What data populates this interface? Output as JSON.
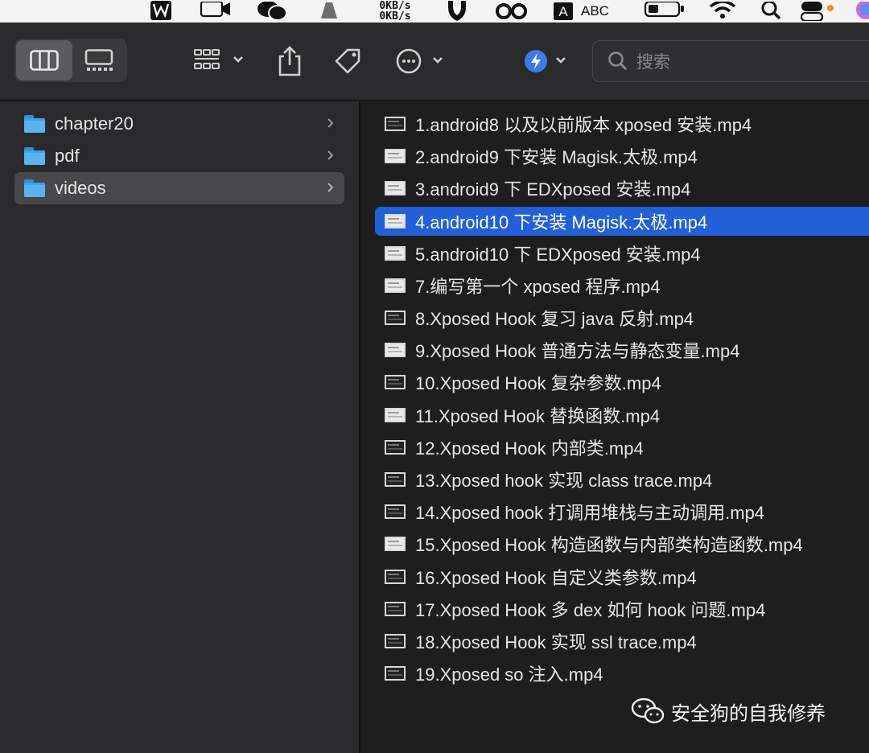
{
  "menubar": {
    "net_up": "0KB/s",
    "net_down": "0KB/s",
    "input_letter": "A",
    "input_label": "ABC"
  },
  "toolbar": {
    "search_placeholder": "搜索",
    "accent": "#2160d6"
  },
  "sidebar": {
    "items": [
      {
        "label": "chapter20",
        "selected": false
      },
      {
        "label": "pdf",
        "selected": false
      },
      {
        "label": "videos",
        "selected": true
      }
    ]
  },
  "files": [
    {
      "name": "1.android8 以及以前版本 xposed 安装.mp4",
      "selected": false
    },
    {
      "name": "2.android9 下安装 Magisk.太极.mp4",
      "selected": false
    },
    {
      "name": "3.android9 下 EDXposed 安装.mp4",
      "selected": false
    },
    {
      "name": "4.android10 下安装 Magisk.太极.mp4",
      "selected": true
    },
    {
      "name": "5.android10 下 EDXposed 安装.mp4",
      "selected": false
    },
    {
      "name": "7.编写第一个 xposed 程序.mp4",
      "selected": false
    },
    {
      "name": "8.Xposed Hook 复习 java 反射.mp4",
      "selected": false
    },
    {
      "name": "9.Xposed Hook 普通方法与静态变量.mp4",
      "selected": false
    },
    {
      "name": "10.Xposed Hook 复杂参数.mp4",
      "selected": false
    },
    {
      "name": "11.Xposed Hook 替换函数.mp4",
      "selected": false
    },
    {
      "name": "12.Xposed Hook 内部类.mp4",
      "selected": false
    },
    {
      "name": "13.Xposed hook 实现 class trace.mp4",
      "selected": false
    },
    {
      "name": "14.Xposed hook 打调用堆栈与主动调用.mp4",
      "selected": false
    },
    {
      "name": "15.Xposed Hook 构造函数与内部类构造函数.mp4",
      "selected": false
    },
    {
      "name": "16.Xposed Hook 自定义类参数.mp4",
      "selected": false
    },
    {
      "name": "17.Xposed Hook 多 dex 如何 hook 问题.mp4",
      "selected": false
    },
    {
      "name": "18.Xposed Hook 实现 ssl trace.mp4",
      "selected": false
    },
    {
      "name": "19.Xposed so 注入.mp4",
      "selected": false
    }
  ],
  "watermark": {
    "text": "安全狗的自我修养"
  }
}
